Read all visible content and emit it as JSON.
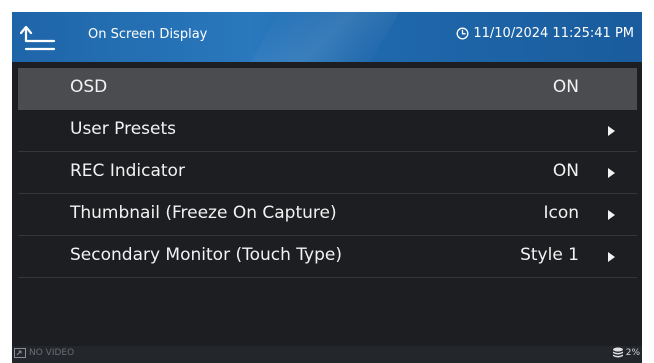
{
  "header": {
    "title": "On Screen Display",
    "datetime": "11/10/2024 11:25:41 PM",
    "back_icon": "back-return-icon",
    "clock_icon": "clock-icon"
  },
  "menu": {
    "items": [
      {
        "label": "OSD",
        "value": "ON",
        "has_arrow": false,
        "selected": true
      },
      {
        "label": "User Presets",
        "value": "",
        "has_arrow": true,
        "selected": false
      },
      {
        "label": "REC Indicator",
        "value": "ON",
        "has_arrow": true,
        "selected": false
      },
      {
        "label": "Thumbnail (Freeze On Capture)",
        "value": "Icon",
        "has_arrow": true,
        "selected": false
      },
      {
        "label": "Secondary Monitor (Touch Type)",
        "value": "Style 1",
        "has_arrow": true,
        "selected": false
      }
    ]
  },
  "status": {
    "video": "NO VIDEO",
    "storage": "2%",
    "video_icon": "video-input-icon",
    "storage_icon": "storage-icon"
  },
  "colors": {
    "header": "#2a78bd",
    "background": "#1c1e21",
    "selected_row": "#4a4c4f",
    "text": "#f2f2f2"
  }
}
